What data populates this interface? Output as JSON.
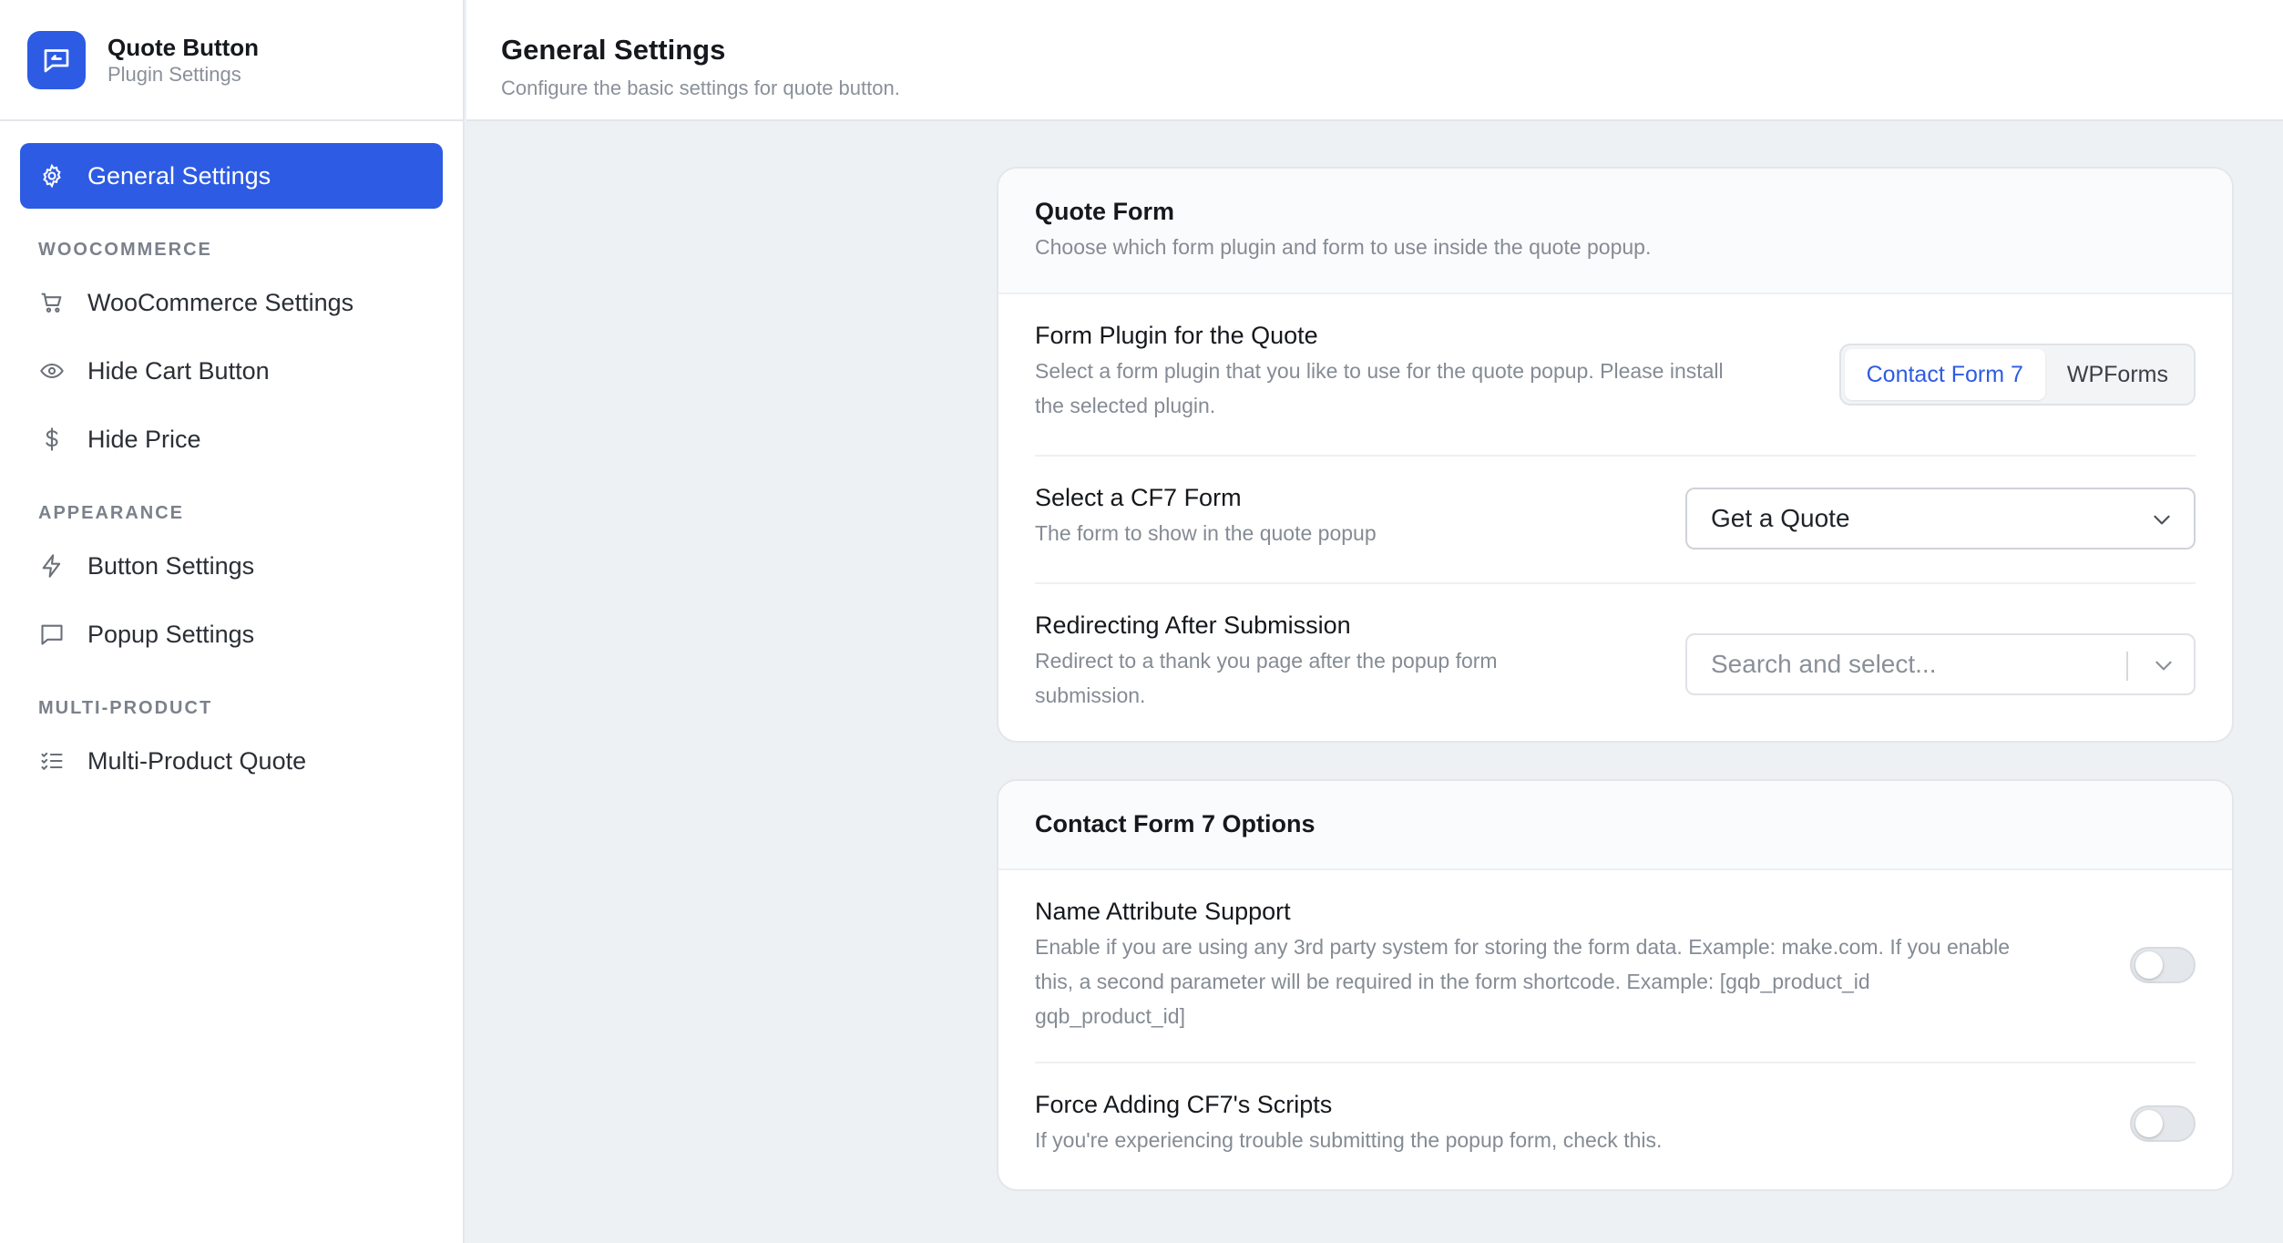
{
  "brand": {
    "title": "Quote Button",
    "subtitle": "Plugin Settings"
  },
  "header": {
    "title": "General Settings",
    "subtitle": "Configure the basic settings for quote button."
  },
  "sidebar": {
    "active": {
      "label": "General Settings",
      "icon": "gear-icon"
    },
    "sections": [
      {
        "label": "WOOCOMMERCE",
        "items": [
          {
            "label": "WooCommerce Settings",
            "icon": "cart-icon"
          },
          {
            "label": "Hide Cart Button",
            "icon": "eye-icon"
          },
          {
            "label": "Hide Price",
            "icon": "dollar-icon"
          }
        ]
      },
      {
        "label": "APPEARANCE",
        "items": [
          {
            "label": "Button Settings",
            "icon": "bolt-icon"
          },
          {
            "label": "Popup Settings",
            "icon": "message-icon"
          }
        ]
      },
      {
        "label": "MULTI-PRODUCT",
        "items": [
          {
            "label": "Multi-Product Quote",
            "icon": "checklist-icon"
          }
        ]
      }
    ]
  },
  "quote_form": {
    "title": "Quote Form",
    "description": "Choose which form plugin and form to use inside the quote popup.",
    "plugin": {
      "title": "Form Plugin for the Quote",
      "description": "Select a form plugin that you like to use for the quote popup. Please install the selected plugin.",
      "options": [
        "Contact Form 7",
        "WPForms"
      ],
      "selected": "Contact Form 7"
    },
    "cf7_form": {
      "title": "Select a CF7 Form",
      "description": "The form to show in the quote popup",
      "value": "Get a Quote"
    },
    "redirect": {
      "title": "Redirecting After Submission",
      "description": "Redirect to a thank you page after the popup form submission.",
      "placeholder": "Search and select..."
    }
  },
  "cf7_options": {
    "title": "Contact Form 7 Options",
    "name_attr": {
      "title": "Name Attribute Support",
      "description": "Enable if you are using any 3rd party system for storing the form data. Example: make.com. If you enable this, a second parameter will be required in the form shortcode. Example: [gqb_product_id gqb_product_id]",
      "enabled": false
    },
    "force_scripts": {
      "title": "Force Adding CF7's Scripts",
      "description": "If you're experiencing trouble submitting the popup form, check this.",
      "enabled": false
    }
  },
  "colors": {
    "accent": "#2d5be3",
    "background": "#eef1f4"
  }
}
